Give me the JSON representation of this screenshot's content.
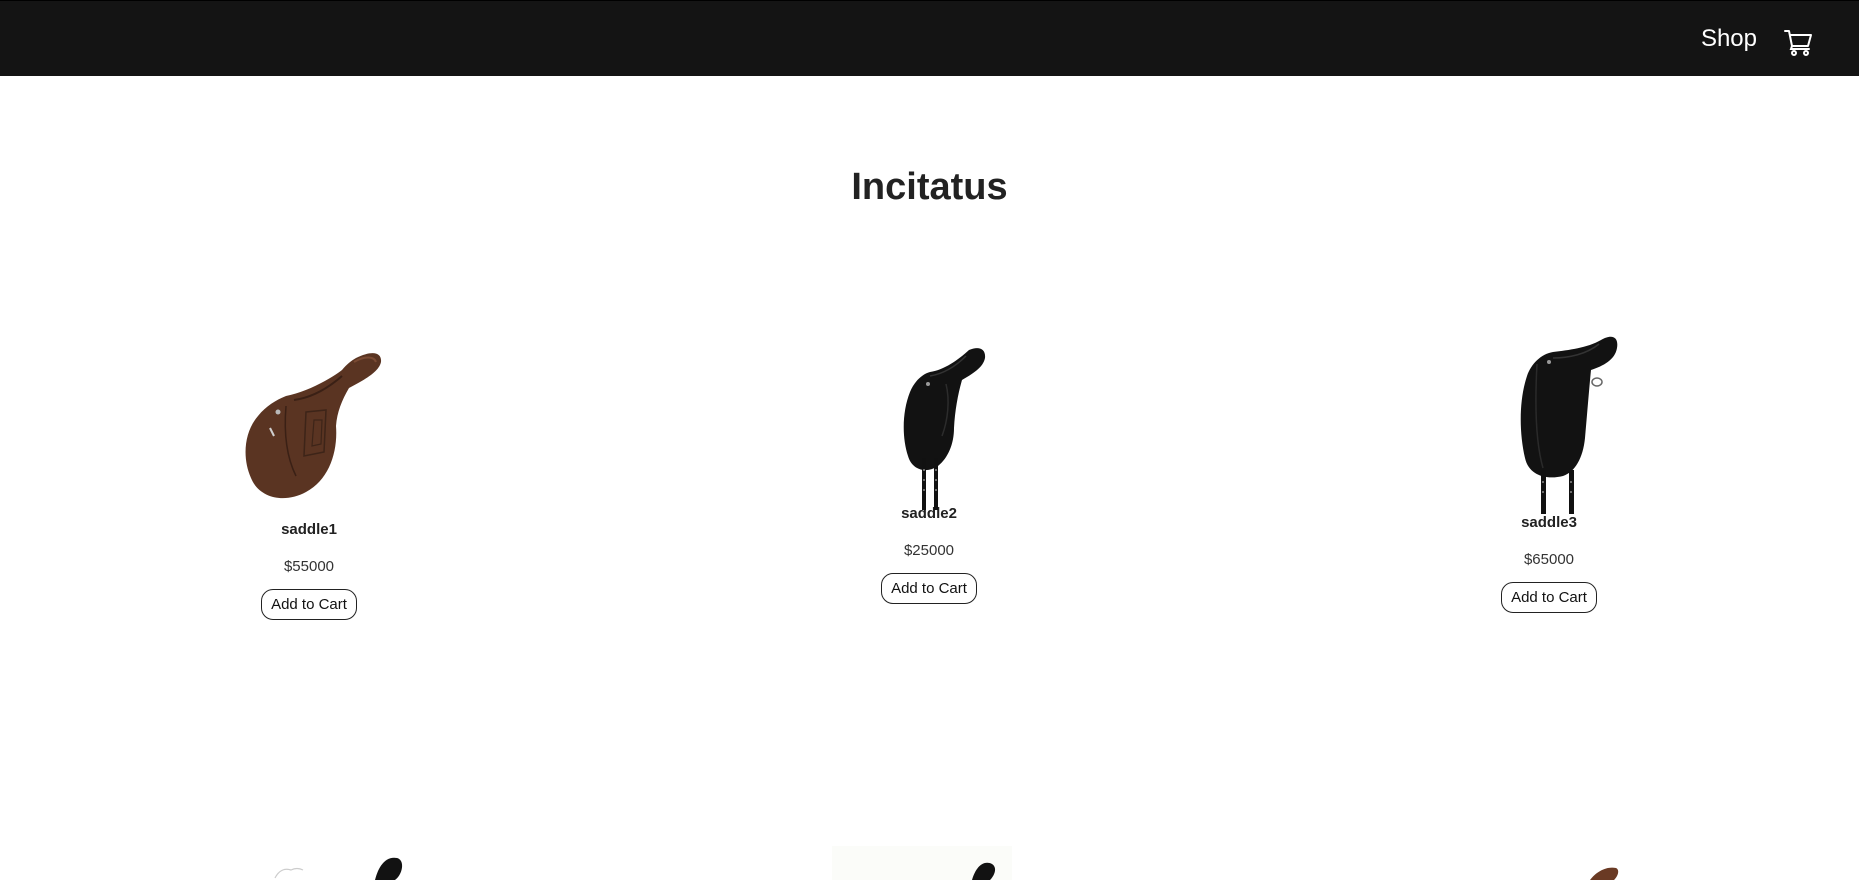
{
  "nav": {
    "shop_label": "Shop",
    "cart_icon": "cart-icon",
    "background": "#141414"
  },
  "page": {
    "title": "Incitatus"
  },
  "products": [
    {
      "name": "saddle1",
      "price": "$55000",
      "button": "Add to Cart",
      "color": "#5a3422",
      "image": "brown-jumping-saddle"
    },
    {
      "name": "saddle2",
      "price": "$25000",
      "button": "Add to Cart",
      "color": "#111111",
      "image": "black-dressage-saddle"
    },
    {
      "name": "saddle3",
      "price": "$65000",
      "button": "Add to Cart",
      "color": "#111111",
      "image": "black-dressage-saddle"
    }
  ],
  "more_products_partial": [
    {
      "image": "black-saddle-partial"
    },
    {
      "image": "black-saddle-partial"
    },
    {
      "image": "brown-saddle-partial"
    }
  ]
}
